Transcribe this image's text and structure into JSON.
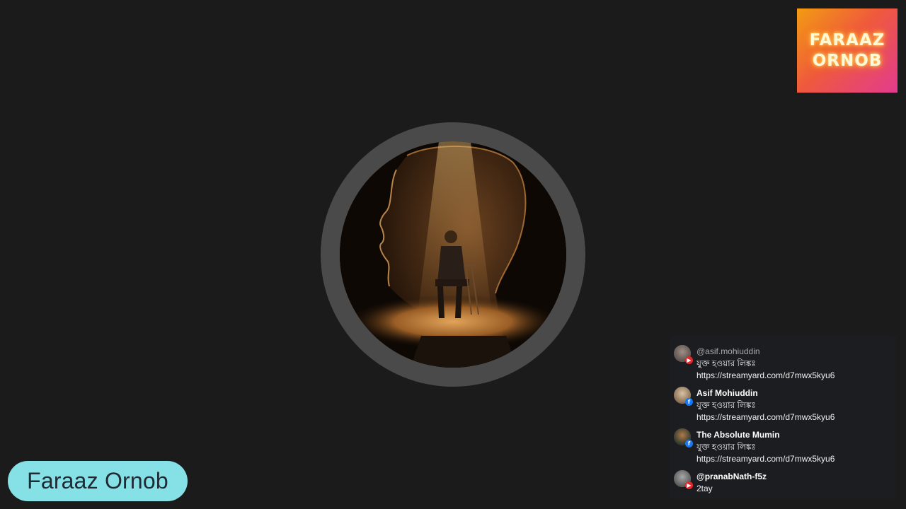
{
  "logo": {
    "line1": "FARAAZ",
    "line2": "ORNOB"
  },
  "name_badge": {
    "label": "Faraaz Ornob"
  },
  "chat": {
    "messages": [
      {
        "author": "@asif.mohiuddin",
        "platform": "youtube",
        "lines": [
          "যুক্ত হওয়ার লিঙ্কঃ",
          "https://streamyard.com/d7mwx5kyu6"
        ]
      },
      {
        "author": "Asif Mohiuddin",
        "platform": "facebook",
        "lines": [
          "যুক্ত হওয়ার লিঙ্কঃ",
          "https://streamyard.com/d7mwx5kyu6"
        ]
      },
      {
        "author": "The Absolute Mumin",
        "platform": "facebook",
        "lines": [
          "যুক্ত হওয়ার লিঙ্কঃ",
          "https://streamyard.com/d7mwx5kyu6"
        ]
      },
      {
        "author": "@pranabNath-f5z",
        "platform": "youtube",
        "lines": [
          "2tay"
        ]
      }
    ]
  },
  "colors": {
    "background": "#1b1b1b",
    "ring": "#4a4a4a",
    "badge_bg": "#86e1e6",
    "badge_text": "#1f2a33",
    "youtube": "#e5262b",
    "facebook": "#1877f2"
  }
}
